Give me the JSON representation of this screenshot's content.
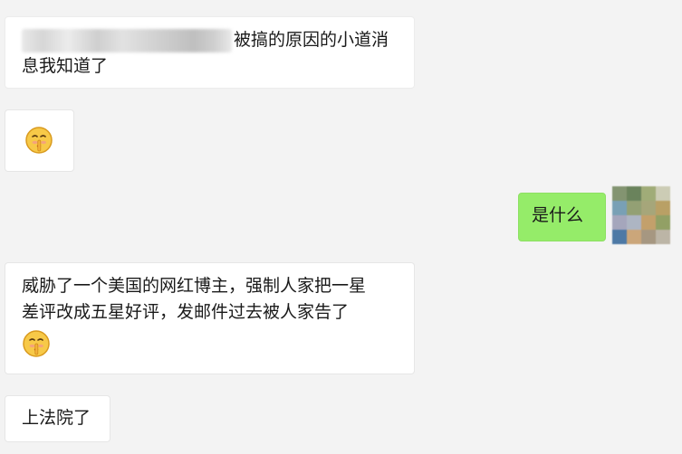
{
  "messages": [
    {
      "side": "left",
      "lines": [
        "被搞的原因的小道消",
        "息我知道了"
      ]
    },
    {
      "side": "left",
      "emoji": "shushing-face"
    },
    {
      "side": "right",
      "text": "是什么"
    },
    {
      "side": "left",
      "lines": [
        "威胁了一个美国的网红博主，强制人家把一星",
        "差评改成五星好评，发邮件过去被人家告了"
      ],
      "emoji": "shushing-face"
    },
    {
      "side": "left",
      "text": "上法院了"
    }
  ],
  "colors": {
    "background": "#f3f3f3",
    "incoming_bubble": "#ffffff",
    "outgoing_bubble": "#95ec69",
    "text": "#1a1a1a"
  },
  "avatar": {
    "mosaic_colors": [
      "#7a8c66",
      "#5f7a50",
      "#9aa66e",
      "#c9c9b0",
      "#6f9ab0",
      "#8b9a6a",
      "#a0a070",
      "#b59a5a",
      "#9fa0b8",
      "#a8b0c0",
      "#c09a60",
      "#8a9a5a",
      "#3f6f9f",
      "#c8a070",
      "#a09078",
      "#b8b0a0"
    ]
  }
}
